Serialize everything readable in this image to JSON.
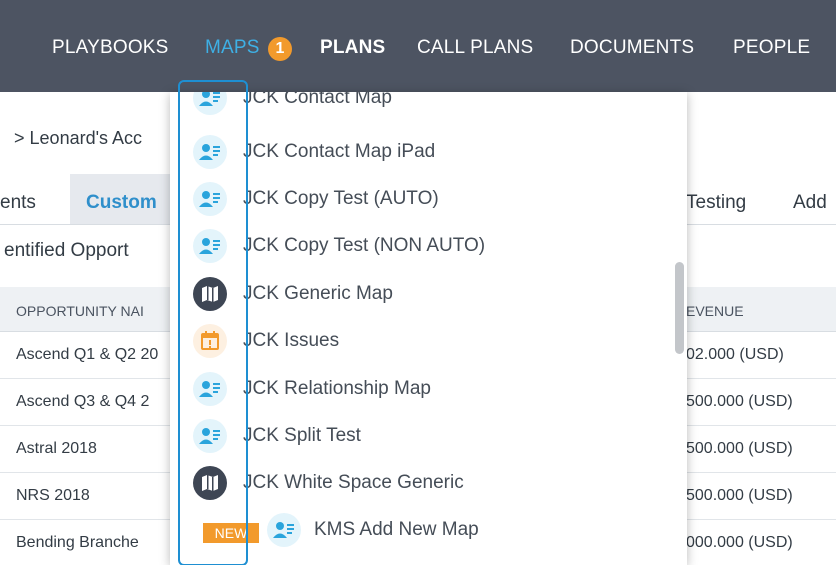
{
  "nav": {
    "items": [
      {
        "label": "PLAYBOOKS"
      },
      {
        "label": "MAPS"
      },
      {
        "label": "PLANS"
      },
      {
        "label": "CALL PLANS"
      },
      {
        "label": "DOCUMENTS"
      },
      {
        "label": "PEOPLE"
      }
    ],
    "maps_badge": "1"
  },
  "breadcrumb": {
    "chevron": ">",
    "text": "Leonard's Acc"
  },
  "tabs": [
    {
      "label": "ents"
    },
    {
      "label": "Custom"
    },
    {
      "label": "Testing"
    },
    {
      "label": "Add"
    }
  ],
  "section_title": "entified Opport",
  "table": {
    "headers": [
      "OPPORTUNITY NAI",
      "EVENUE"
    ],
    "rows": [
      {
        "name": "Ascend Q1 & Q2 20",
        "revenue": "02.000 (USD)"
      },
      {
        "name": "Ascend Q3 & Q4 2",
        "revenue": "500.000 (USD)"
      },
      {
        "name": "Astral 2018",
        "revenue": "500.000 (USD)"
      },
      {
        "name": "NRS 2018",
        "revenue": "500.000 (USD)"
      },
      {
        "name": "Bending Branche",
        "revenue": "000.000 (USD)"
      }
    ]
  },
  "dropdown": {
    "items": [
      {
        "label": "JCK Contact Map",
        "icon": "contact-map-icon"
      },
      {
        "label": "JCK Contact Map iPad",
        "icon": "contact-map-icon"
      },
      {
        "label": "JCK Copy Test (AUTO)",
        "icon": "contact-map-icon"
      },
      {
        "label": "JCK Copy Test (NON AUTO)",
        "icon": "contact-map-icon"
      },
      {
        "label": "JCK Generic Map",
        "icon": "map-icon"
      },
      {
        "label": "JCK Issues",
        "icon": "calendar-alert-icon"
      },
      {
        "label": "JCK Relationship Map",
        "icon": "contact-map-icon"
      },
      {
        "label": "JCK Split Test",
        "icon": "contact-map-icon"
      },
      {
        "label": "JCK White Space Generic",
        "icon": "map-icon"
      },
      {
        "label": "KMS Add New Map",
        "icon": "contact-map-icon",
        "badge": "NEW"
      }
    ]
  },
  "colors": {
    "nav_bg": "#4d5462",
    "accent": "#3eb0e5",
    "badge": "#f29a2c",
    "highlight": "#1e8fd2"
  }
}
